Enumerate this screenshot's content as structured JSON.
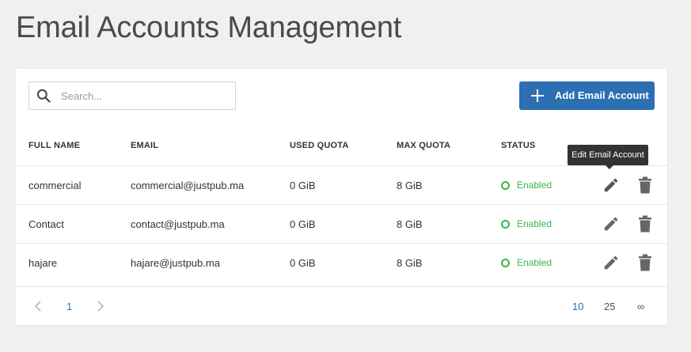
{
  "page": {
    "title": "Email Accounts Management"
  },
  "toolbar": {
    "search_placeholder": "Search...",
    "add_label": "Add Email Account"
  },
  "table": {
    "headers": [
      "FULL NAME",
      "EMAIL",
      "USED QUOTA",
      "MAX QUOTA",
      "STATUS"
    ],
    "rows": [
      {
        "full_name": "commercial",
        "email": "commercial@justpub.ma",
        "used_quota": "0 GiB",
        "max_quota": "8 GiB",
        "status": "Enabled"
      },
      {
        "full_name": "Contact",
        "email": "contact@justpub.ma",
        "used_quota": "0 GiB",
        "max_quota": "8 GiB",
        "status": "Enabled"
      },
      {
        "full_name": "hajare",
        "email": "hajare@justpub.ma",
        "used_quota": "0 GiB",
        "max_quota": "8 GiB",
        "status": "Enabled"
      }
    ]
  },
  "tooltip": {
    "text": "Edit Email Account"
  },
  "pagination": {
    "current_page": "1",
    "per_page_options": [
      "10",
      "25",
      "∞"
    ],
    "selected_per_page": "10"
  },
  "colors": {
    "accent": "#2c6fb3",
    "status_enabled": "#39b54a",
    "icon": "#666666"
  }
}
